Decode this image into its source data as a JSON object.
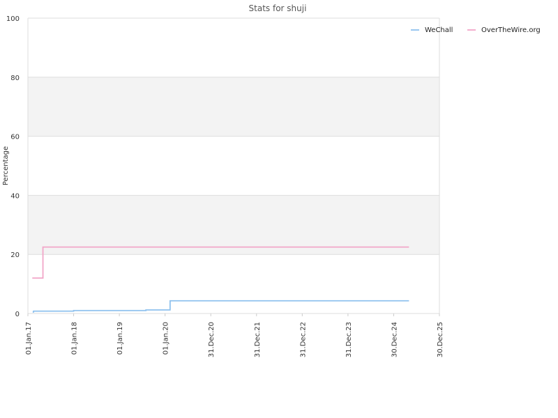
{
  "chart_data": {
    "type": "line",
    "title": "Stats for shuji",
    "xlabel": "",
    "ylabel": "Percentage",
    "ylim": [
      0,
      100
    ],
    "yticks": [
      0,
      20,
      40,
      60,
      80,
      100
    ],
    "xlim": [
      "2017-01-01",
      "2025-12-30"
    ],
    "xticks": [
      {
        "date": "2017-01-01",
        "label": "01.Jan.17"
      },
      {
        "date": "2018-01-01",
        "label": "01.Jan.18"
      },
      {
        "date": "2019-01-01",
        "label": "01.Jan.19"
      },
      {
        "date": "2020-01-01",
        "label": "01.Jan.20"
      },
      {
        "date": "2020-12-31",
        "label": "31.Dec.20"
      },
      {
        "date": "2021-12-31",
        "label": "31.Dec.21"
      },
      {
        "date": "2022-12-31",
        "label": "31.Dec.22"
      },
      {
        "date": "2023-12-31",
        "label": "31.Dec.23"
      },
      {
        "date": "2024-12-30",
        "label": "30.Dec.24"
      },
      {
        "date": "2025-12-30",
        "label": "30.Dec.25"
      }
    ],
    "grid": true,
    "alternating_bands": true,
    "legend_position": "top-right",
    "step": true,
    "series": [
      {
        "name": "WeChall",
        "color": "#8ec1ee",
        "points": [
          {
            "x": "2017-02-08",
            "y": 0.5
          },
          {
            "x": "2017-02-15",
            "y": 0.8
          },
          {
            "x": "2018-01-01",
            "y": 1.0
          },
          {
            "x": "2019-08-01",
            "y": 1.2
          },
          {
            "x": "2020-02-10",
            "y": 4.3
          },
          {
            "x": "2025-05-01",
            "y": 4.3
          }
        ]
      },
      {
        "name": "OverTheWire.org",
        "color": "#f2a6c8",
        "points": [
          {
            "x": "2017-02-05",
            "y": 12.0
          },
          {
            "x": "2017-05-01",
            "y": 22.5
          },
          {
            "x": "2025-05-01",
            "y": 22.5
          }
        ]
      }
    ]
  }
}
